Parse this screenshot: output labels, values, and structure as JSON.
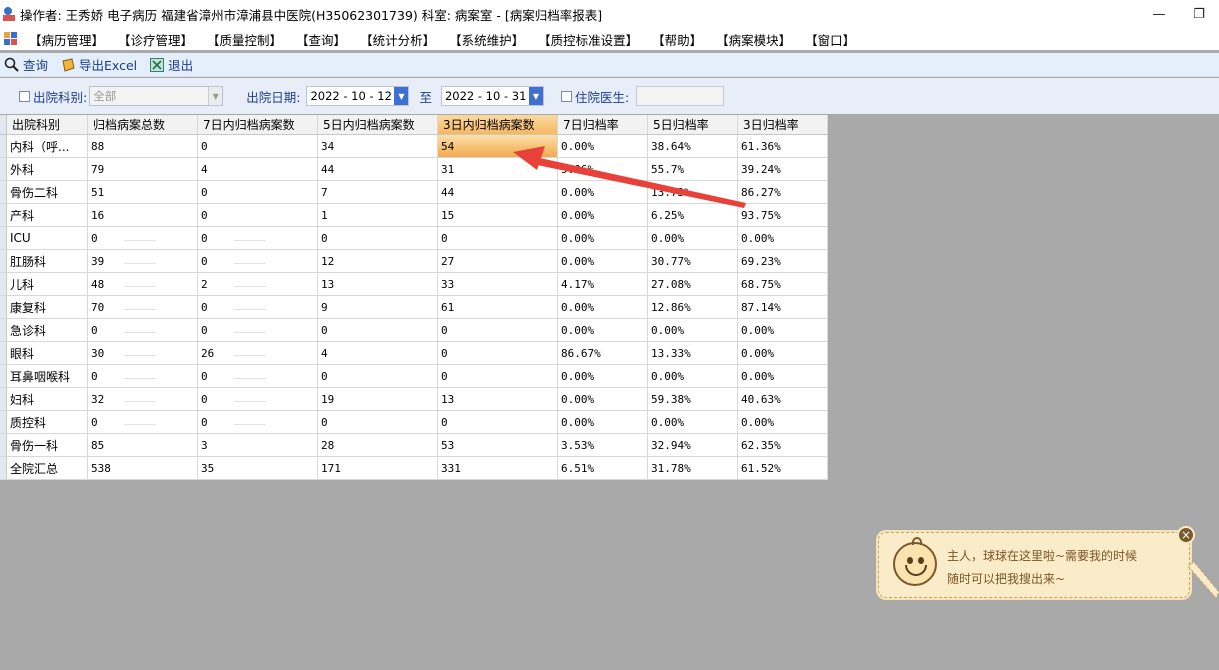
{
  "window": {
    "title": "操作者: 王秀娇 电子病历  福建省漳州市漳浦县中医院(H35062301739)  科室: 病案室 - [病案归档率报表]",
    "minimize_glyph": "—",
    "restore_glyph": "❐"
  },
  "menu": {
    "items": [
      "【病历管理】",
      "【诊疗管理】",
      "【质量控制】",
      "【查询】",
      "【统计分析】",
      "【系统维护】",
      "【质控标准设置】",
      "【帮助】",
      "【病案模块】",
      "【窗口】"
    ]
  },
  "toolbar": {
    "query_label": "查询",
    "export_label": "导出Excel",
    "exit_label": "退出"
  },
  "filters": {
    "discharge_dept_label": "出院科别:",
    "discharge_dept_value": "全部",
    "discharge_date_label": "出院日期:",
    "date_from": "2022 - 10 - 12",
    "to_label": "至",
    "date_to": "2022 - 10 - 31",
    "doctor_label": "住院医生:",
    "doctor_value": ""
  },
  "table": {
    "columns": [
      "出院科别",
      "归档病案总数",
      "7日内归档病案数",
      "5日内归档病案数",
      "3日内归档病案数",
      "7日归档率",
      "5日归档率",
      "3日归档率"
    ],
    "selected_column": 4,
    "rows": [
      [
        "内科（呼...",
        "88",
        "0",
        "34",
        "54",
        "0.00%",
        "38.64%",
        "61.36%"
      ],
      [
        "外科",
        "79",
        "4",
        "44",
        "31",
        "5.06%",
        "55.7%",
        "39.24%"
      ],
      [
        "骨伤二科",
        "51",
        "0",
        "7",
        "44",
        "0.00%",
        "13.73%",
        "86.27%"
      ],
      [
        "产科",
        "16",
        "0",
        "1",
        "15",
        "0.00%",
        "6.25%",
        "93.75%"
      ],
      [
        "ICU",
        "0",
        "0",
        "0",
        "0",
        "0.00%",
        "0.00%",
        "0.00%"
      ],
      [
        "肛肠科",
        "39",
        "0",
        "12",
        "27",
        "0.00%",
        "30.77%",
        "69.23%"
      ],
      [
        "儿科",
        "48",
        "2",
        "13",
        "33",
        "4.17%",
        "27.08%",
        "68.75%"
      ],
      [
        "康复科",
        "70",
        "0",
        "9",
        "61",
        "0.00%",
        "12.86%",
        "87.14%"
      ],
      [
        "急诊科",
        "0",
        "0",
        "0",
        "0",
        "0.00%",
        "0.00%",
        "0.00%"
      ],
      [
        "眼科",
        "30",
        "26",
        "4",
        "0",
        "86.67%",
        "13.33%",
        "0.00%"
      ],
      [
        "耳鼻咽喉科",
        "0",
        "0",
        "0",
        "0",
        "0.00%",
        "0.00%",
        "0.00%"
      ],
      [
        "妇科",
        "32",
        "0",
        "19",
        "13",
        "0.00%",
        "59.38%",
        "40.63%"
      ],
      [
        "质控科",
        "0",
        "0",
        "0",
        "0",
        "0.00%",
        "0.00%",
        "0.00%"
      ],
      [
        "骨伤一科",
        "85",
        "3",
        "28",
        "53",
        "3.53%",
        "32.94%",
        "62.35%"
      ],
      [
        "全院汇总",
        "538",
        "35",
        "171",
        "331",
        "6.51%",
        "31.78%",
        "61.52%"
      ]
    ]
  },
  "assistant": {
    "line1": "主人，球球在这里啦~需要我的时候",
    "line2": "随时可以把我搜出来~",
    "close_glyph": "×"
  },
  "colors": {
    "annotation_arrow": "#e8413a",
    "selection": "#f6b862",
    "toolbar_text": "#1a3c8f"
  }
}
